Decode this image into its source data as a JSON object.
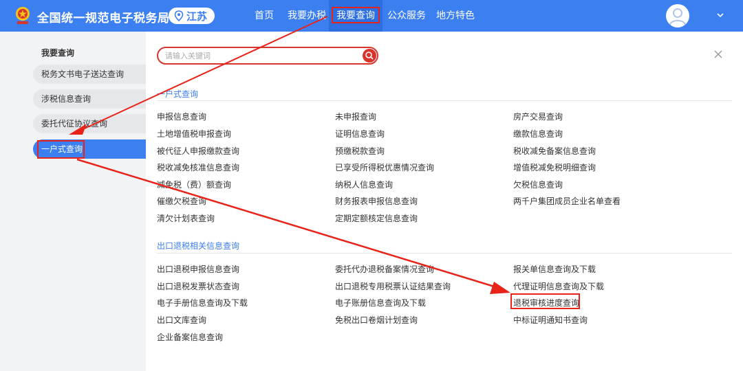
{
  "header": {
    "site_title": "全国统一规范电子税务局",
    "region": "江苏",
    "nav": [
      {
        "label": "首页"
      },
      {
        "label": "我要办税"
      },
      {
        "label": "我要查询"
      },
      {
        "label": "公众服务"
      },
      {
        "label": "地方特色"
      }
    ],
    "accent_color": "#3c7ff0",
    "highlight_color": "#e8231a"
  },
  "sidebar": {
    "title": "我要查询",
    "items": [
      {
        "label": "税务文书电子送达查询"
      },
      {
        "label": "涉税信息查询"
      },
      {
        "label": "委托代征协议查询"
      },
      {
        "label": "一户式查询"
      }
    ]
  },
  "main": {
    "search_placeholder": "请输入关键词",
    "sections": [
      {
        "title": "一户式查询",
        "columns": [
          [
            "申报信息查询",
            "土地增值税申报查询",
            "被代征人申报缴款查询",
            "税收减免核准信息查询",
            "减免税（费）额查询",
            "催缴欠税查询",
            "清欠计划表查询"
          ],
          [
            "未申报查询",
            "证明信息查询",
            "预缴税款查询",
            "已享受所得税优惠情况查询",
            "纳税人信息查询",
            "财务报表申报信息查询",
            "定期定额核定信息查询"
          ],
          [
            "房产交易查询",
            "缴款信息查询",
            "税收减免备案信息查询",
            "增值税减免税明细查询",
            "欠税信息查询",
            "两千户集团成员企业名单查看"
          ]
        ]
      },
      {
        "title": "出口退税相关信息查询",
        "columns": [
          [
            "出口退税申报信息查询",
            "出口退税发票状态查询",
            "电子手册信息查询及下载",
            "出口文库查询",
            "企业备案信息查询"
          ],
          [
            "委托代办退税备案情况查询",
            "出口退税专用税票认证结果查询",
            "电子账册信息查询及下载",
            "免税出口卷烟计划查询"
          ],
          [
            "报关单信息查询及下载",
            "代理证明信息查询及下载",
            "退税审核进度查询",
            "中标证明通知书查询"
          ]
        ]
      }
    ]
  }
}
